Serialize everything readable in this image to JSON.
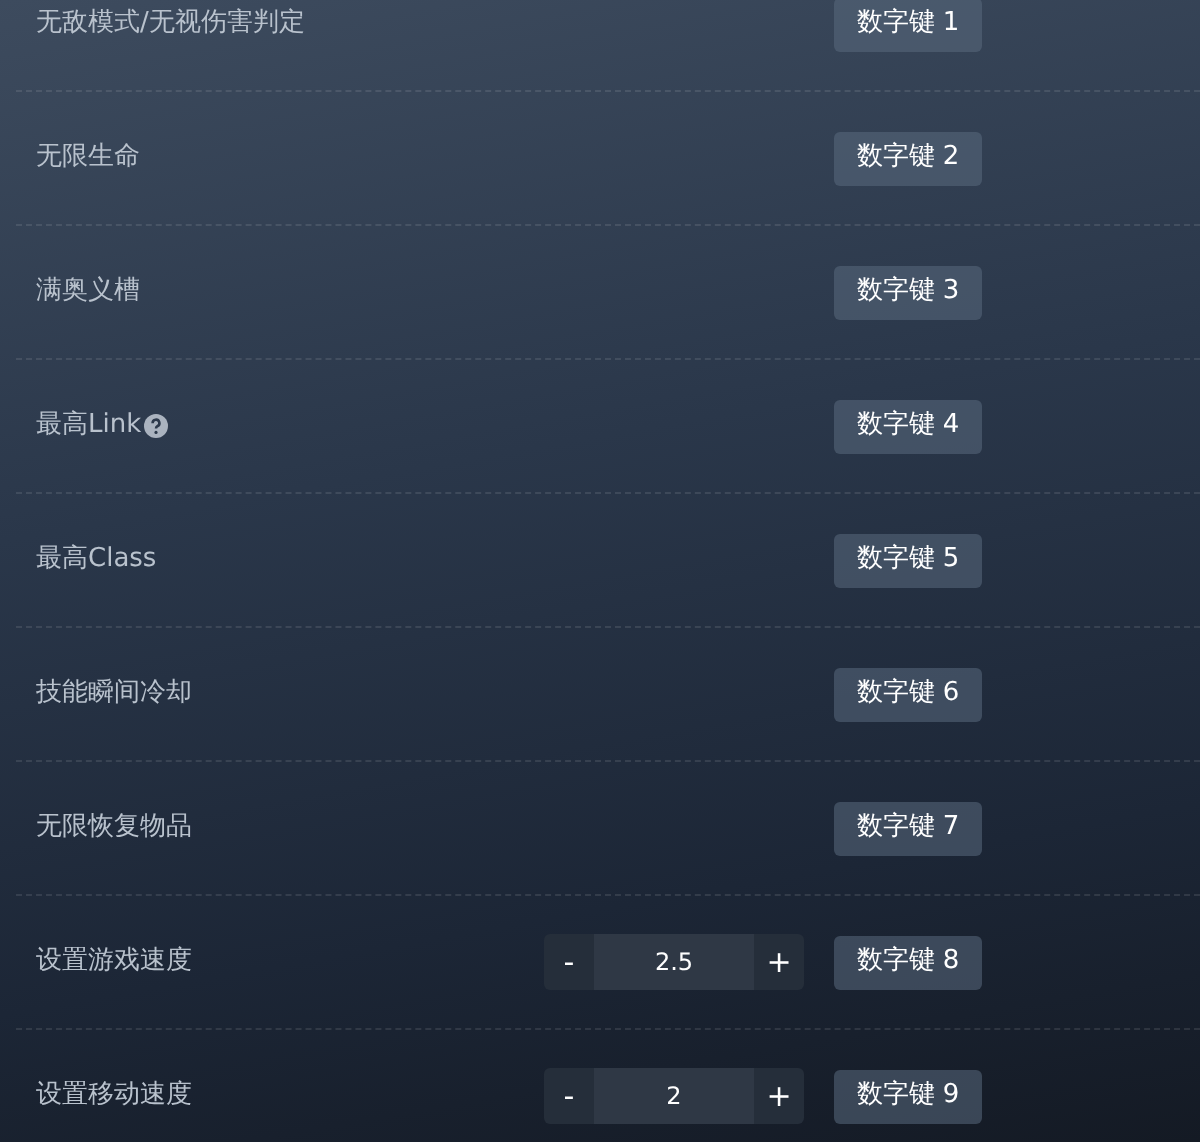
{
  "options": [
    {
      "kind": "hotkey",
      "label": "无敌模式/无视伤害判定",
      "key": "数字键 1"
    },
    {
      "kind": "hotkey",
      "label": "无限生命",
      "key": "数字键 2"
    },
    {
      "kind": "hotkey",
      "label": "满奥义槽",
      "key": "数字键 3"
    },
    {
      "kind": "hotkey",
      "label": "最高Link",
      "help": true,
      "key": "数字键 4"
    },
    {
      "kind": "hotkey",
      "label": "最高Class",
      "key": "数字键 5"
    },
    {
      "kind": "hotkey",
      "label": "技能瞬间冷却",
      "key": "数字键 6"
    },
    {
      "kind": "hotkey",
      "label": "无限恢复物品",
      "key": "数字键 7"
    },
    {
      "kind": "stepper",
      "label": "设置游戏速度",
      "minus": "-",
      "value": "2.5",
      "plus": "+",
      "key": "数字键 8"
    },
    {
      "kind": "stepper",
      "label": "设置移动速度",
      "minus": "-",
      "value": "2",
      "plus": "+",
      "key": "数字键 9"
    }
  ]
}
